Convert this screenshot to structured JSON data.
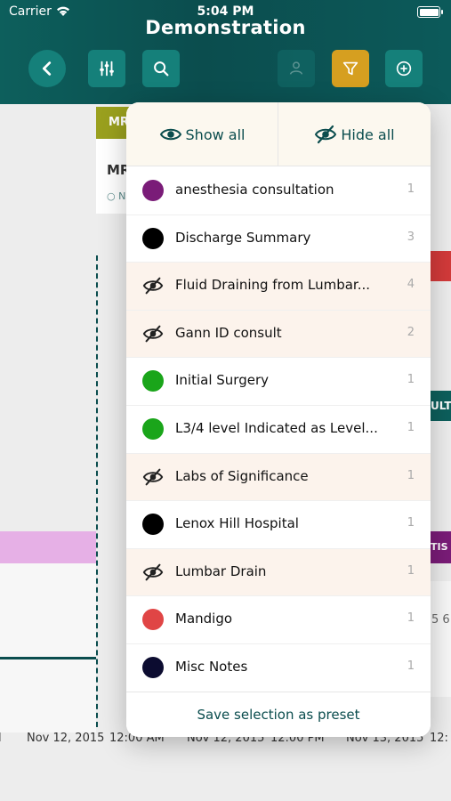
{
  "status": {
    "carrier": "Carrier",
    "time": "5:04 PM"
  },
  "header": {
    "title": "Demonstration"
  },
  "background": {
    "card_tag": "MR",
    "card_title": "MR",
    "card_bullet": "N",
    "right_tag_teal": "ULT",
    "right_tag_purple": "TIS",
    "right_numbers": "5 6",
    "axis_labels": [
      "l",
      "Nov 12, 2015",
      "12:00 AM",
      "Nov 12, 2015",
      "12:00 PM",
      "Nov 13, 2015",
      "12:"
    ]
  },
  "popover": {
    "show_all": "Show all",
    "hide_all": "Hide all",
    "items": [
      {
        "label": "anesthesia consultation",
        "count": "1",
        "visible": true,
        "color": "#7a1c78"
      },
      {
        "label": "Discharge Summary",
        "count": "3",
        "visible": true,
        "color": "#000000"
      },
      {
        "label": "Fluid Draining from Lumbar...",
        "count": "4",
        "visible": false,
        "color": ""
      },
      {
        "label": "Gann ID consult",
        "count": "2",
        "visible": false,
        "color": ""
      },
      {
        "label": "Initial Surgery",
        "count": "1",
        "visible": true,
        "color": "#1aa51a"
      },
      {
        "label": "L3/4 level Indicated as Level...",
        "count": "1",
        "visible": true,
        "color": "#1aa51a"
      },
      {
        "label": "Labs of Significance",
        "count": "1",
        "visible": false,
        "color": ""
      },
      {
        "label": "Lenox Hill Hospital",
        "count": "1",
        "visible": true,
        "color": "#000000"
      },
      {
        "label": "Lumbar Drain",
        "count": "1",
        "visible": false,
        "color": ""
      },
      {
        "label": "Mandigo",
        "count": "1",
        "visible": true,
        "color": "#e04545"
      },
      {
        "label": "Misc Notes",
        "count": "1",
        "visible": true,
        "color": "#0c0c30"
      }
    ],
    "footer": "Save selection as preset"
  },
  "colors": {
    "header": "#0b4d4e",
    "accent": "#d69f20",
    "hidden_row": "#fcf3ec"
  },
  "icons": [
    "wifi-icon",
    "battery-icon",
    "back-icon",
    "sliders-icon",
    "search-icon",
    "person-icon",
    "filter-icon",
    "add-icon",
    "eye-icon",
    "eye-off-icon"
  ]
}
